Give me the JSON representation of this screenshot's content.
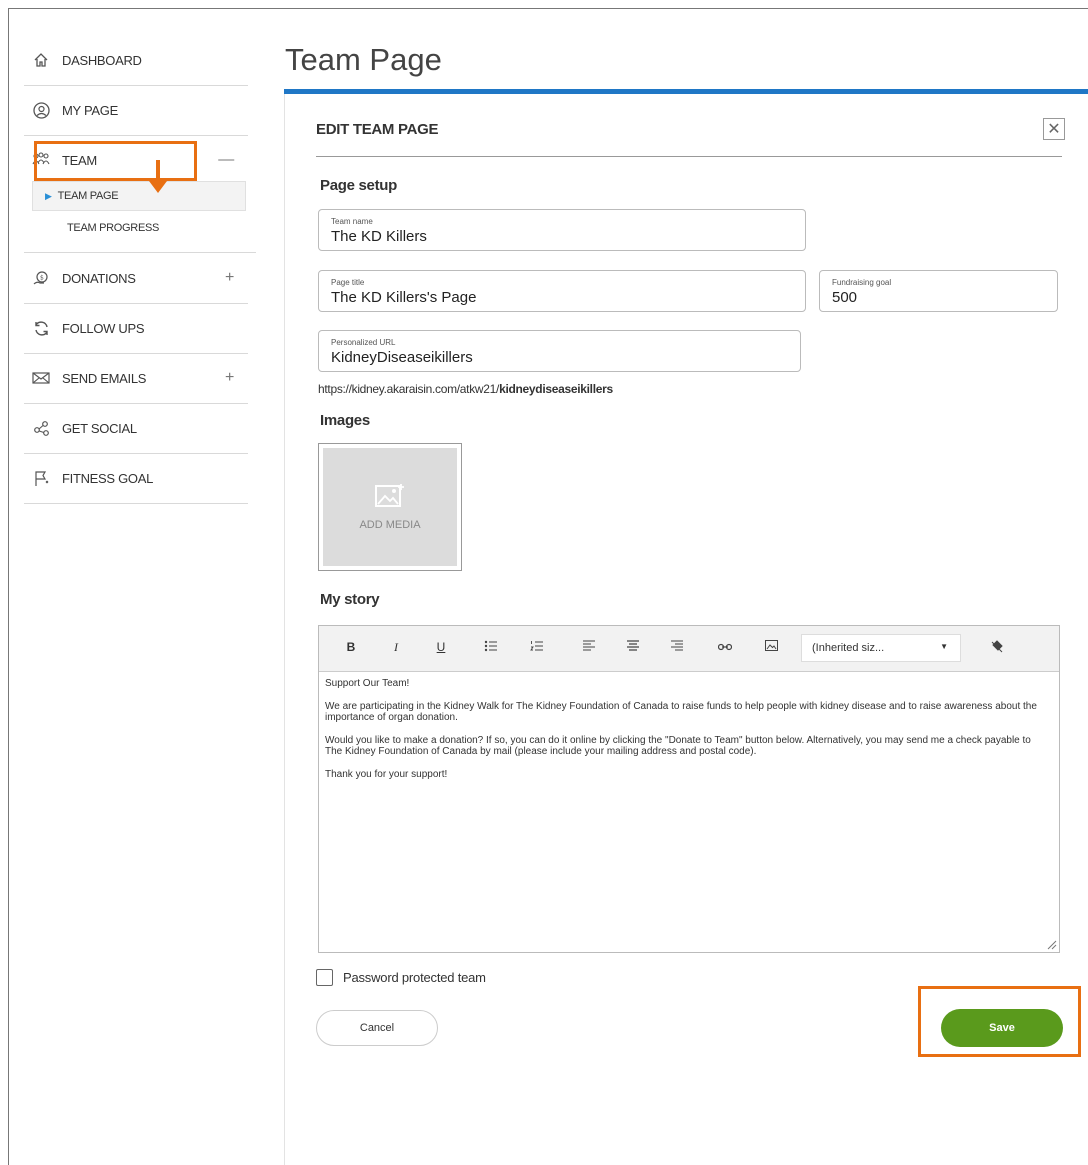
{
  "sidebar": {
    "items": [
      {
        "label": "DASHBOARD",
        "icon": "home-icon"
      },
      {
        "label": "MY PAGE",
        "icon": "user-circle-icon"
      },
      {
        "label": "TEAM",
        "icon": "team-icon",
        "toggle": "—"
      },
      {
        "label": "DONATIONS",
        "icon": "donation-icon",
        "toggle": "+"
      },
      {
        "label": "FOLLOW UPS",
        "icon": "refresh-icon"
      },
      {
        "label": "SEND EMAILS",
        "icon": "envelope-icon",
        "toggle": "+"
      },
      {
        "label": "GET SOCIAL",
        "icon": "share-icon"
      },
      {
        "label": "FITNESS GOAL",
        "icon": "flag-icon"
      }
    ],
    "team_sub": {
      "active": "TEAM PAGE",
      "other": "TEAM PROGRESS"
    }
  },
  "main": {
    "title": "Team Page",
    "panel_title": "EDIT TEAM PAGE",
    "close_glyph": "✕",
    "page_setup_heading": "Page setup",
    "team_name": {
      "label": "Team name",
      "value": "The KD Killers"
    },
    "page_title": {
      "label": "Page title",
      "value": "The KD Killers's Page"
    },
    "fundraising_goal": {
      "label": "Fundraising goal",
      "value": "500"
    },
    "personalized_url": {
      "label": "Personalized URL",
      "value": "KidneyDiseaseikillers"
    },
    "url_prefix": "https://kidney.akaraisin.com/atkw21/",
    "url_slug": "kidneydiseaseikillers",
    "images_heading": "Images",
    "add_media": "ADD MEDIA",
    "story_heading": "My story",
    "toolbar": {
      "bold": "B",
      "italic": "I",
      "underline": "U",
      "font_size": "(Inherited siz..."
    },
    "story": [
      "Support Our Team!",
      "We are participating in the Kidney Walk for The Kidney Foundation of Canada to raise funds to help people with kidney disease and to raise awareness about the importance of organ donation.",
      "Would you like to make a donation? If so, you can do it online by clicking the \"Donate to Team\" button below. Alternatively, you may send me a check payable to The Kidney Foundation of Canada by mail (please include your mailing address and postal code).",
      "Thank you for your support!"
    ],
    "password_protected": "Password protected team",
    "cancel": "Cancel",
    "save": "Save"
  },
  "colors": {
    "accent_blue": "#1f77c6",
    "highlight_orange": "#e86f12",
    "save_green": "#5a9a1c"
  }
}
